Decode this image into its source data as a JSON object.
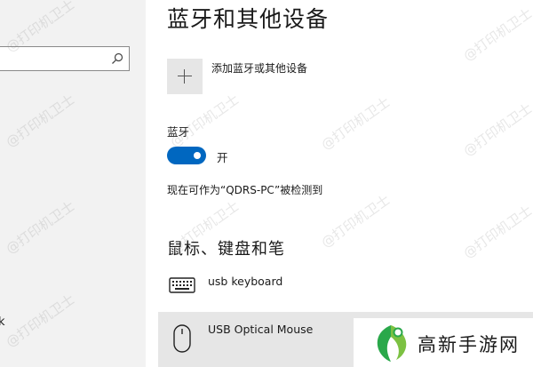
{
  "nav": {
    "search": {
      "value": "",
      "placeholder": "",
      "icon": "search-icon"
    },
    "partial_item": "k"
  },
  "main": {
    "title": "蓝牙和其他设备",
    "add_device": {
      "icon": "plus-icon",
      "label": "添加蓝牙或其他设备"
    },
    "bluetooth": {
      "label": "蓝牙",
      "toggle_on": true,
      "toggle_state": "开",
      "accent": "#0067c0"
    },
    "discoverable": "现在可作为“QDRS-PC”被检测到",
    "section_heading": "鼠标、键盘和笔",
    "devices": [
      {
        "name": "usb keyboard",
        "icon": "keyboard-icon",
        "selected": false
      },
      {
        "name": "USB Optical Mouse",
        "icon": "mouse-icon",
        "selected": true
      }
    ]
  },
  "watermark": "@打印机卫士",
  "brand": {
    "text": "高新手游网",
    "logo_color": "#2aa84a"
  }
}
